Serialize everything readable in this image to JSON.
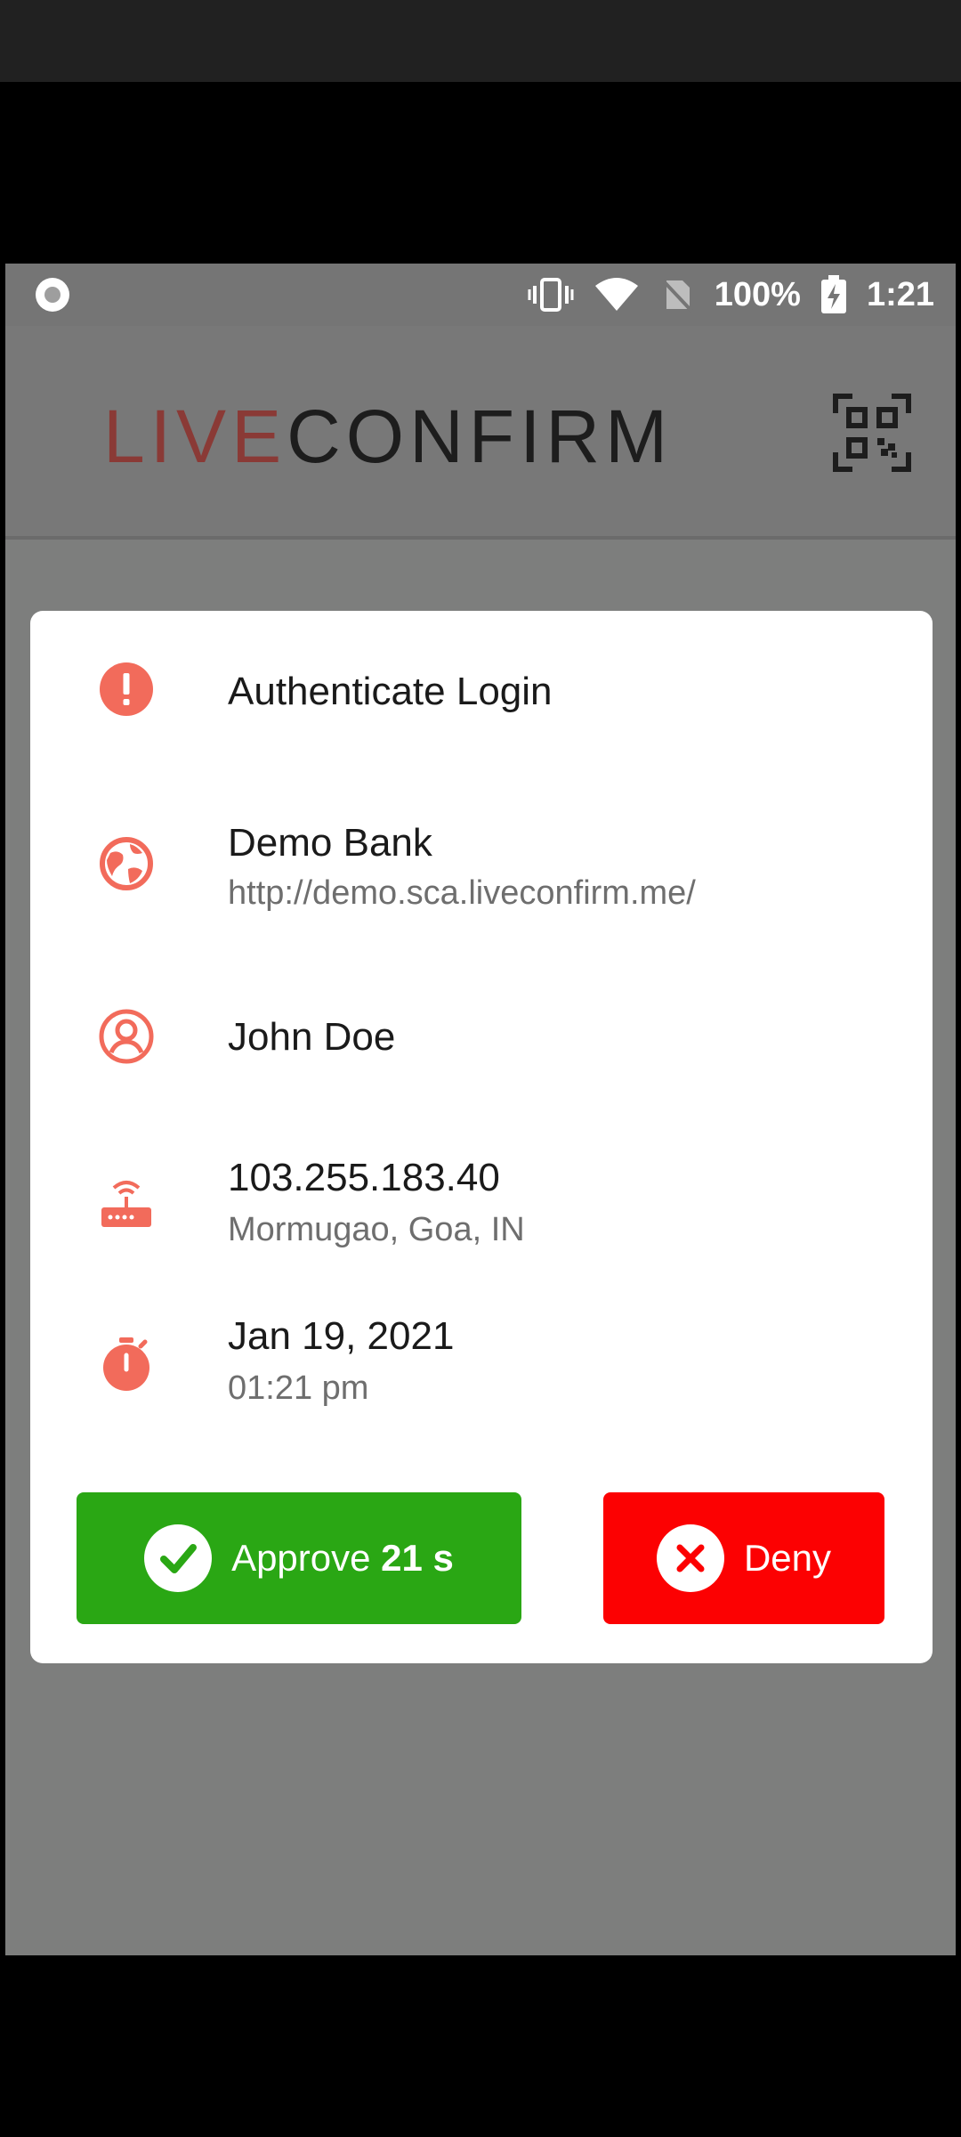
{
  "status_bar": {
    "battery": "100%",
    "time": "1:21",
    "icons": [
      "vibrate-icon",
      "wifi-icon",
      "no-sim-icon",
      "battery-charging-icon"
    ]
  },
  "header": {
    "logo_part_a": "LIVE",
    "logo_part_b": "CONFIRM",
    "qr_icon": "qr-scan-icon"
  },
  "request": {
    "title": "Authenticate Login",
    "title_icon": "alert-icon",
    "service_name": "Demo Bank",
    "service_url": "http://demo.sca.liveconfirm.me/",
    "service_icon": "globe-icon",
    "user_name": "John Doe",
    "user_icon": "user-circle-icon",
    "ip_address": "103.255.183.40",
    "location": "Mormugao, Goa, IN",
    "network_icon": "router-icon",
    "date": "Jan 19, 2021",
    "time": "01:21 pm",
    "time_icon": "stopwatch-icon"
  },
  "actions": {
    "approve_label": "Approve",
    "approve_countdown": "21 s",
    "deny_label": "Deny"
  },
  "colors": {
    "accent": "#f26b5b",
    "approve": "#2aa714",
    "deny": "#fc0102"
  }
}
